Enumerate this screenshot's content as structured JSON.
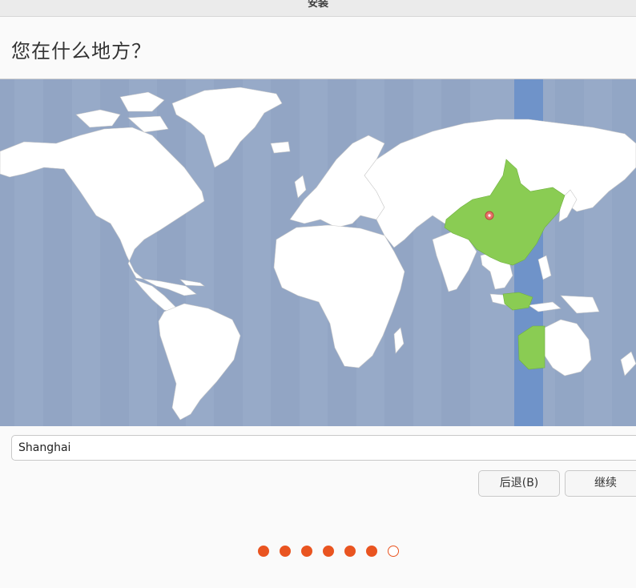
{
  "window": {
    "title": "安装"
  },
  "page": {
    "title": "您在什么地方？"
  },
  "map": {
    "selected_city": "Shanghai",
    "water_color": "#97aac8",
    "land_color": "#ffffff",
    "selected_zone_color": "#7b9acb",
    "selected_country_color": "#8acc53",
    "marker_color": "#e8726a"
  },
  "location": {
    "value": "Shanghai"
  },
  "buttons": {
    "back": "后退(B)",
    "continue": "继续"
  },
  "progress": {
    "total_steps": 7,
    "completed_steps": 6
  },
  "accent_color": "#e95420"
}
